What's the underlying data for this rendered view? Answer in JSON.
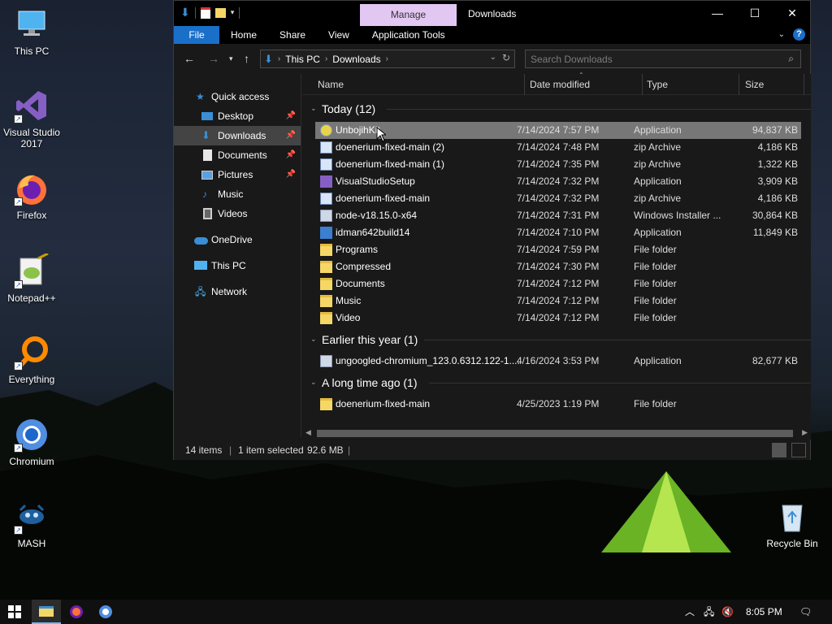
{
  "desktop": {
    "icons": [
      {
        "label": "This PC"
      },
      {
        "label": "Visual Studio 2017"
      },
      {
        "label": "Firefox"
      },
      {
        "label": "Notepad++"
      },
      {
        "label": "Everything"
      },
      {
        "label": "Chromium"
      },
      {
        "label": "MASH"
      },
      {
        "label": "Recycle Bin"
      }
    ]
  },
  "window": {
    "contextual_tab": "Manage",
    "title": "Downloads",
    "ribbon_tabs": [
      "File",
      "Home",
      "Share",
      "View",
      "Application Tools"
    ],
    "help_label": "?",
    "address": {
      "crumbs": [
        "This PC",
        "Downloads"
      ]
    },
    "search": {
      "placeholder": "Search Downloads"
    },
    "nav": [
      {
        "label": "Quick access"
      },
      {
        "label": "Desktop"
      },
      {
        "label": "Downloads"
      },
      {
        "label": "Documents"
      },
      {
        "label": "Pictures"
      },
      {
        "label": "Music"
      },
      {
        "label": "Videos"
      },
      {
        "label": "OneDrive"
      },
      {
        "label": "This PC"
      },
      {
        "label": "Network"
      }
    ],
    "columns": {
      "name": "Name",
      "date": "Date modified",
      "type": "Type",
      "size": "Size"
    },
    "groups": [
      {
        "title": "Today (12)",
        "files": [
          {
            "name": "UnbojihKit",
            "date": "7/14/2024 7:57 PM",
            "type": "Application",
            "size": "94,837 KB",
            "icon": "app-icon"
          },
          {
            "name": "doenerium-fixed-main (2)",
            "date": "7/14/2024 7:48 PM",
            "type": "zip Archive",
            "size": "4,186 KB",
            "icon": "zip-icon"
          },
          {
            "name": "doenerium-fixed-main (1)",
            "date": "7/14/2024 7:35 PM",
            "type": "zip Archive",
            "size": "1,322 KB",
            "icon": "zip-icon"
          },
          {
            "name": "VisualStudioSetup",
            "date": "7/14/2024 7:32 PM",
            "type": "Application",
            "size": "3,909 KB",
            "icon": "vs-icon"
          },
          {
            "name": "doenerium-fixed-main",
            "date": "7/14/2024 7:32 PM",
            "type": "zip Archive",
            "size": "4,186 KB",
            "icon": "zip-icon"
          },
          {
            "name": "node-v18.15.0-x64",
            "date": "7/14/2024 7:31 PM",
            "type": "Windows Installer ...",
            "size": "30,864 KB",
            "icon": "installer-icon"
          },
          {
            "name": "idman642build14",
            "date": "7/14/2024 7:10 PM",
            "type": "Application",
            "size": "11,849 KB",
            "icon": "app-icon"
          },
          {
            "name": "Programs",
            "date": "7/14/2024 7:59 PM",
            "type": "File folder",
            "size": "",
            "icon": "folder-icon"
          },
          {
            "name": "Compressed",
            "date": "7/14/2024 7:30 PM",
            "type": "File folder",
            "size": "",
            "icon": "folder-icon"
          },
          {
            "name": "Documents",
            "date": "7/14/2024 7:12 PM",
            "type": "File folder",
            "size": "",
            "icon": "folder-icon"
          },
          {
            "name": "Music",
            "date": "7/14/2024 7:12 PM",
            "type": "File folder",
            "size": "",
            "icon": "folder-icon"
          },
          {
            "name": "Video",
            "date": "7/14/2024 7:12 PM",
            "type": "File folder",
            "size": "",
            "icon": "folder-icon"
          }
        ]
      },
      {
        "title": "Earlier this year (1)",
        "files": [
          {
            "name": "ungoogled-chromium_123.0.6312.122-1....",
            "date": "4/16/2024 3:53 PM",
            "type": "Application",
            "size": "82,677 KB",
            "icon": "app-icon"
          }
        ]
      },
      {
        "title": "A long time ago (1)",
        "files": [
          {
            "name": "doenerium-fixed-main",
            "date": "4/25/2023 1:19 PM",
            "type": "File folder",
            "size": "",
            "icon": "folder-icon"
          }
        ]
      }
    ],
    "status": {
      "count": "14 items",
      "selected": "1 item selected",
      "size": "92.6 MB"
    }
  },
  "taskbar": {
    "clock": "8:05 PM"
  },
  "colors": {
    "accent": "#1a6fc9",
    "manage_tab": "#e2c7f3",
    "selection": "#777777",
    "folder": "#f5d766"
  }
}
